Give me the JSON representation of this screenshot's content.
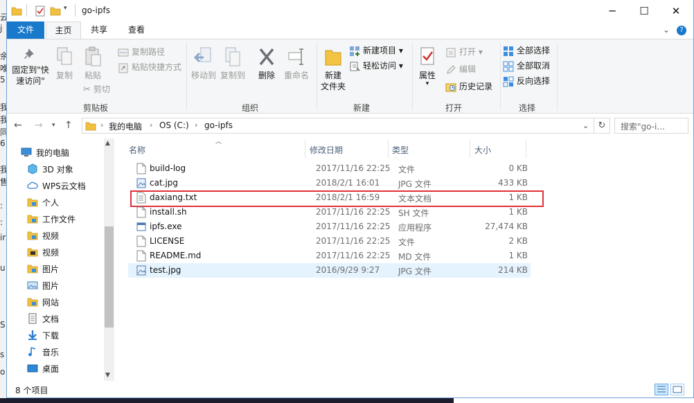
{
  "window": {
    "title": "go-ipfs",
    "controls": {
      "minimize": "─",
      "maximize": "☐",
      "close": "✕"
    }
  },
  "ribbon_tabs": [
    "文件",
    "主页",
    "共享",
    "查看"
  ],
  "ribbon": {
    "clipboard": {
      "group_label": "剪贴板",
      "pin_label_1": "固定到\"快",
      "pin_label_2": "速访问\"",
      "copy_label": "复制",
      "paste_label": "粘贴",
      "copy_path_label": "复制路径",
      "paste_shortcut_label": "粘贴快捷方式",
      "cut_label": "剪切"
    },
    "organize": {
      "group_label": "组织",
      "move_to_label": "移动到",
      "copy_to_label": "复制到",
      "delete_label": "删除",
      "rename_label": "重命名"
    },
    "new": {
      "group_label": "新建",
      "new_folder_label_1": "新建",
      "new_folder_label_2": "文件夹",
      "new_item_label": "新建项目 ▾",
      "easy_access_label": "轻松访问 ▾"
    },
    "open": {
      "group_label": "打开",
      "properties_label": "属性",
      "open_label": "打开 ▾",
      "edit_label": "编辑",
      "history_label": "历史记录"
    },
    "select": {
      "group_label": "选择",
      "select_all_label": "全部选择",
      "select_none_label": "全部取消",
      "invert_label": "反向选择"
    }
  },
  "address": {
    "crumbs": [
      "我的电脑",
      "OS (C:)",
      "go-ipfs"
    ],
    "search_placeholder": "搜索\"go-i..."
  },
  "nav_items": [
    {
      "label": "我的电脑",
      "icon": "computer-icon"
    },
    {
      "label": "3D 对象",
      "icon": "3d-objects-icon"
    },
    {
      "label": "WPS云文档",
      "icon": "cloud-icon"
    },
    {
      "label": "个人",
      "icon": "folder-icon"
    },
    {
      "label": "工作文件",
      "icon": "folder-icon"
    },
    {
      "label": "视频",
      "icon": "folder-icon"
    },
    {
      "label": "视频",
      "icon": "video-icon"
    },
    {
      "label": "图片",
      "icon": "folder-icon"
    },
    {
      "label": "图片",
      "icon": "pictures-icon"
    },
    {
      "label": "网站",
      "icon": "folder-icon"
    },
    {
      "label": "文档",
      "icon": "documents-icon"
    },
    {
      "label": "下载",
      "icon": "download-icon"
    },
    {
      "label": "音乐",
      "icon": "music-icon"
    },
    {
      "label": "桌面",
      "icon": "desktop-icon"
    }
  ],
  "columns": {
    "name": "名称",
    "date": "修改日期",
    "type": "类型",
    "size": "大小"
  },
  "files": [
    {
      "name": "build-log",
      "date": "2017/11/16 22:25",
      "type": "文件",
      "size": "0 KB",
      "icon": "file-icon"
    },
    {
      "name": "cat.jpg",
      "date": "2018/2/1 16:01",
      "type": "JPG 文件",
      "size": "433 KB",
      "icon": "image-file-icon"
    },
    {
      "name": "daxiang.txt",
      "date": "2018/2/1 16:59",
      "type": "文本文档",
      "size": "1 KB",
      "icon": "text-file-icon"
    },
    {
      "name": "install.sh",
      "date": "2017/11/16 22:25",
      "type": "SH 文件",
      "size": "1 KB",
      "icon": "file-icon"
    },
    {
      "name": "ipfs.exe",
      "date": "2017/11/16 22:25",
      "type": "应用程序",
      "size": "27,474 KB",
      "icon": "exe-icon"
    },
    {
      "name": "LICENSE",
      "date": "2017/11/16 22:25",
      "type": "文件",
      "size": "2 KB",
      "icon": "file-icon"
    },
    {
      "name": "README.md",
      "date": "2017/11/16 22:25",
      "type": "MD 文件",
      "size": "1 KB",
      "icon": "file-icon"
    },
    {
      "name": "test.jpg",
      "date": "2016/9/29 9:27",
      "type": "JPG 文件",
      "size": "214 KB",
      "icon": "image-file-icon"
    }
  ],
  "status": {
    "item_count": "8 个项目"
  },
  "background_fragments": [
    "云",
    "j",
    "余",
    "唯",
    "5",
    "我",
    "我",
    "同",
    "6",
    "我",
    "售",
    ":",
    ":",
    "ir",
    "u",
    "S",
    "s",
    "o"
  ]
}
